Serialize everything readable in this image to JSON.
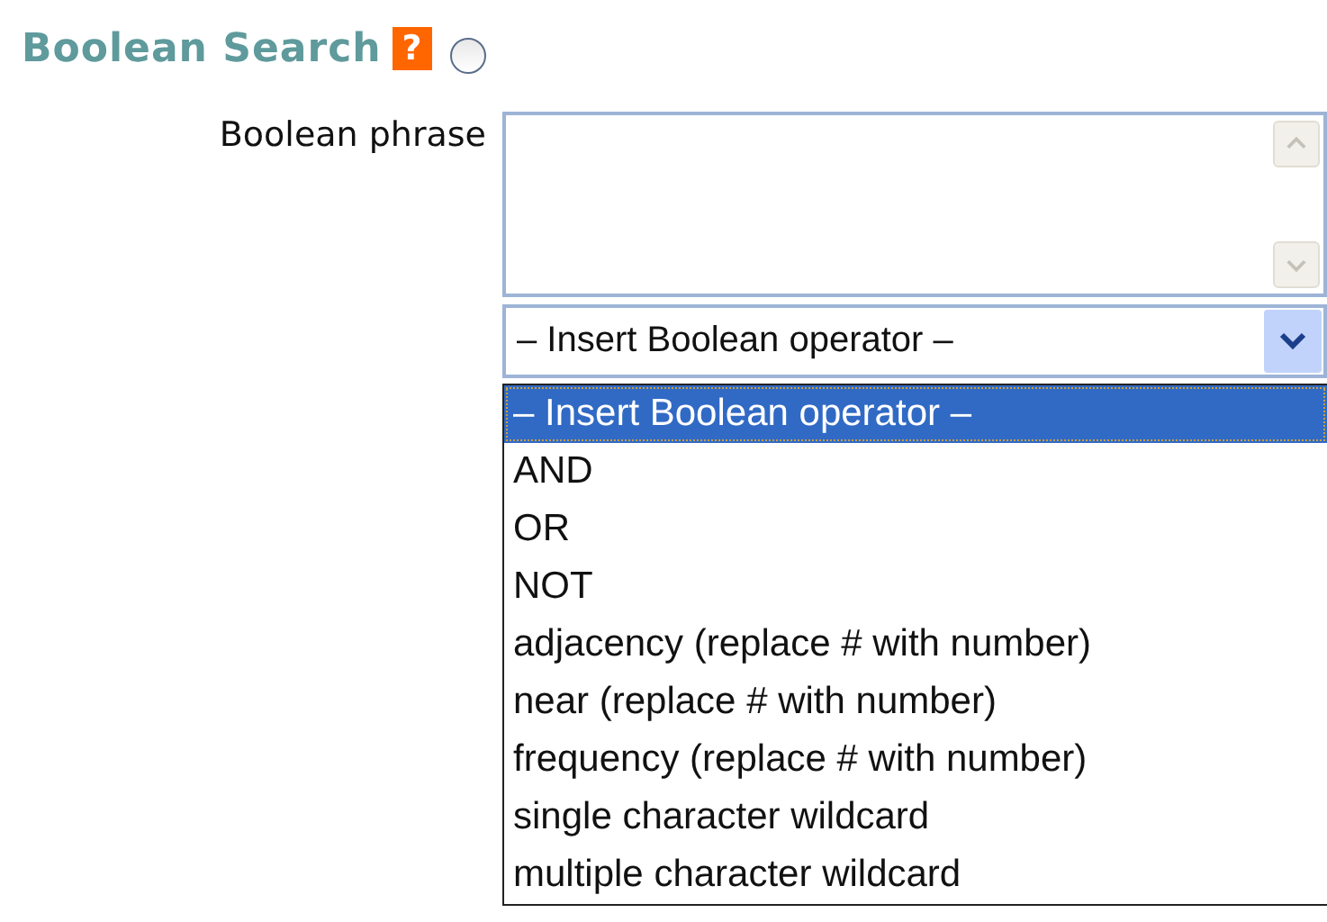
{
  "section": {
    "title": "Boolean Search",
    "help": "?",
    "radio": {
      "selected": false
    }
  },
  "phrase": {
    "label": "Boolean phrase"
  },
  "operator_select": {
    "value": "– Insert Boolean operator –",
    "expanded": true,
    "options": [
      {
        "label": "– Insert Boolean operator –",
        "selected": true
      },
      {
        "label": "AND",
        "selected": false
      },
      {
        "label": "OR",
        "selected": false
      },
      {
        "label": "NOT",
        "selected": false
      },
      {
        "label": "adjacency (replace # with number)",
        "selected": false
      },
      {
        "label": "near (replace # with number)",
        "selected": false
      },
      {
        "label": "frequency (replace # with number)",
        "selected": false
      },
      {
        "label": "single character wildcard",
        "selected": false
      },
      {
        "label": "multiple character wildcard",
        "selected": false
      }
    ]
  }
}
